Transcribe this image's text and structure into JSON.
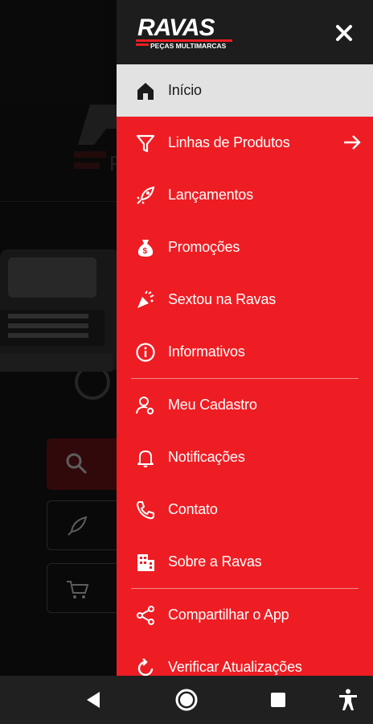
{
  "app": {
    "logo_text": "RAVAS",
    "logo_subtitle": "PEÇAS MULTIMARCAS"
  },
  "colors": {
    "brand_red": "#ee1d23",
    "header_dark": "#1d1d1d",
    "active_item_bg": "#e2e2e2",
    "navbar": "#202020"
  },
  "drawer": {
    "close_icon": "close-icon",
    "items": [
      {
        "label": "Início",
        "icon": "home-icon",
        "active": true
      },
      {
        "label": "Linhas de Produtos",
        "icon": "filter-icon",
        "trailing": "arrow-right-icon"
      },
      {
        "label": "Lançamentos",
        "icon": "rocket-icon"
      },
      {
        "label": "Promoções",
        "icon": "money-bag-icon"
      },
      {
        "label": "Sextou na Ravas",
        "icon": "party-popper-icon"
      },
      {
        "label": "Informativos",
        "icon": "info-icon"
      },
      {
        "label": "Meu Cadastro",
        "icon": "user-settings-icon"
      },
      {
        "label": "Notificações",
        "icon": "bell-icon"
      },
      {
        "label": "Contato",
        "icon": "phone-icon"
      },
      {
        "label": "Sobre a Ravas",
        "icon": "building-icon"
      },
      {
        "label": "Compartilhar o App",
        "icon": "share-icon"
      },
      {
        "label": "Verificar Atualizações",
        "icon": "refresh-icon"
      }
    ]
  },
  "navbar": {
    "buttons": [
      "back-icon",
      "home-circle-icon",
      "recents-icon",
      "accessibility-icon"
    ]
  }
}
